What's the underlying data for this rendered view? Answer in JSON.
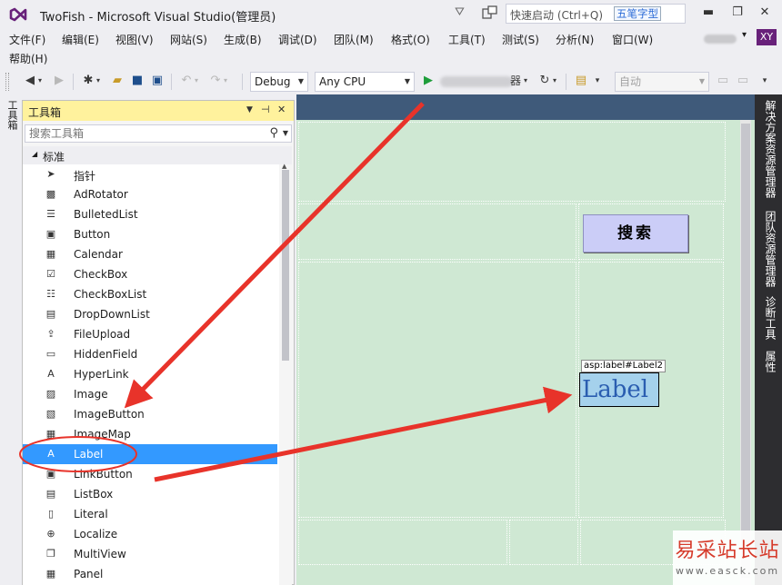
{
  "window": {
    "title": "TwoFish - Microsoft Visual Studio(管理员)",
    "quick_launch_placeholder": "快速启动 (Ctrl+Q)",
    "ime_label": "五笔字型",
    "user_initials": "XY",
    "accent_color": "#68217a"
  },
  "menu": {
    "items": [
      "文件(F)",
      "编辑(E)",
      "视图(V)",
      "网站(S)",
      "生成(B)",
      "调试(D)",
      "团队(M)",
      "格式(O)",
      "工具(T)",
      "测试(S)",
      "分析(N)",
      "窗口(W)",
      "帮助(H)"
    ]
  },
  "toolbar": {
    "config": "Debug",
    "platform": "Any CPU",
    "run_suffix": "器",
    "font_combo": "自动"
  },
  "left_strip": {
    "tab": "工具箱"
  },
  "toolbox": {
    "title": "工具箱",
    "search_placeholder": "搜索工具箱",
    "group": "标准",
    "items": [
      {
        "label": "指针",
        "icon": "pointer-icon"
      },
      {
        "label": "AdRotator",
        "icon": "adrotator-icon"
      },
      {
        "label": "BulletedList",
        "icon": "bulletedlist-icon"
      },
      {
        "label": "Button",
        "icon": "button-icon"
      },
      {
        "label": "Calendar",
        "icon": "calendar-icon"
      },
      {
        "label": "CheckBox",
        "icon": "checkbox-icon"
      },
      {
        "label": "CheckBoxList",
        "icon": "checkboxlist-icon"
      },
      {
        "label": "DropDownList",
        "icon": "dropdownlist-icon"
      },
      {
        "label": "FileUpload",
        "icon": "fileupload-icon"
      },
      {
        "label": "HiddenField",
        "icon": "hiddenfield-icon"
      },
      {
        "label": "HyperLink",
        "icon": "hyperlink-icon"
      },
      {
        "label": "Image",
        "icon": "image-icon"
      },
      {
        "label": "ImageButton",
        "icon": "imagebutton-icon"
      },
      {
        "label": "ImageMap",
        "icon": "imagemap-icon"
      },
      {
        "label": "Label",
        "icon": "label-icon",
        "selected": true
      },
      {
        "label": "LinkButton",
        "icon": "linkbutton-icon"
      },
      {
        "label": "ListBox",
        "icon": "listbox-icon"
      },
      {
        "label": "Literal",
        "icon": "literal-icon"
      },
      {
        "label": "Localize",
        "icon": "localize-icon"
      },
      {
        "label": "MultiView",
        "icon": "multiview-icon"
      },
      {
        "label": "Panel",
        "icon": "panel-icon"
      }
    ],
    "selection_color": "#3399ff"
  },
  "designer": {
    "search_button_text": "搜索",
    "label_tag": "asp:label#Label2",
    "label_text": "Label",
    "background_color": "#cfe8d3"
  },
  "right_strip": {
    "tabs": [
      "解决方案资源管理器",
      "团队资源管理器",
      "诊断工具",
      "属性"
    ]
  },
  "watermark": {
    "text": "易采站长站",
    "url": "www.easck.com"
  },
  "annotation_color": "#e8332a"
}
